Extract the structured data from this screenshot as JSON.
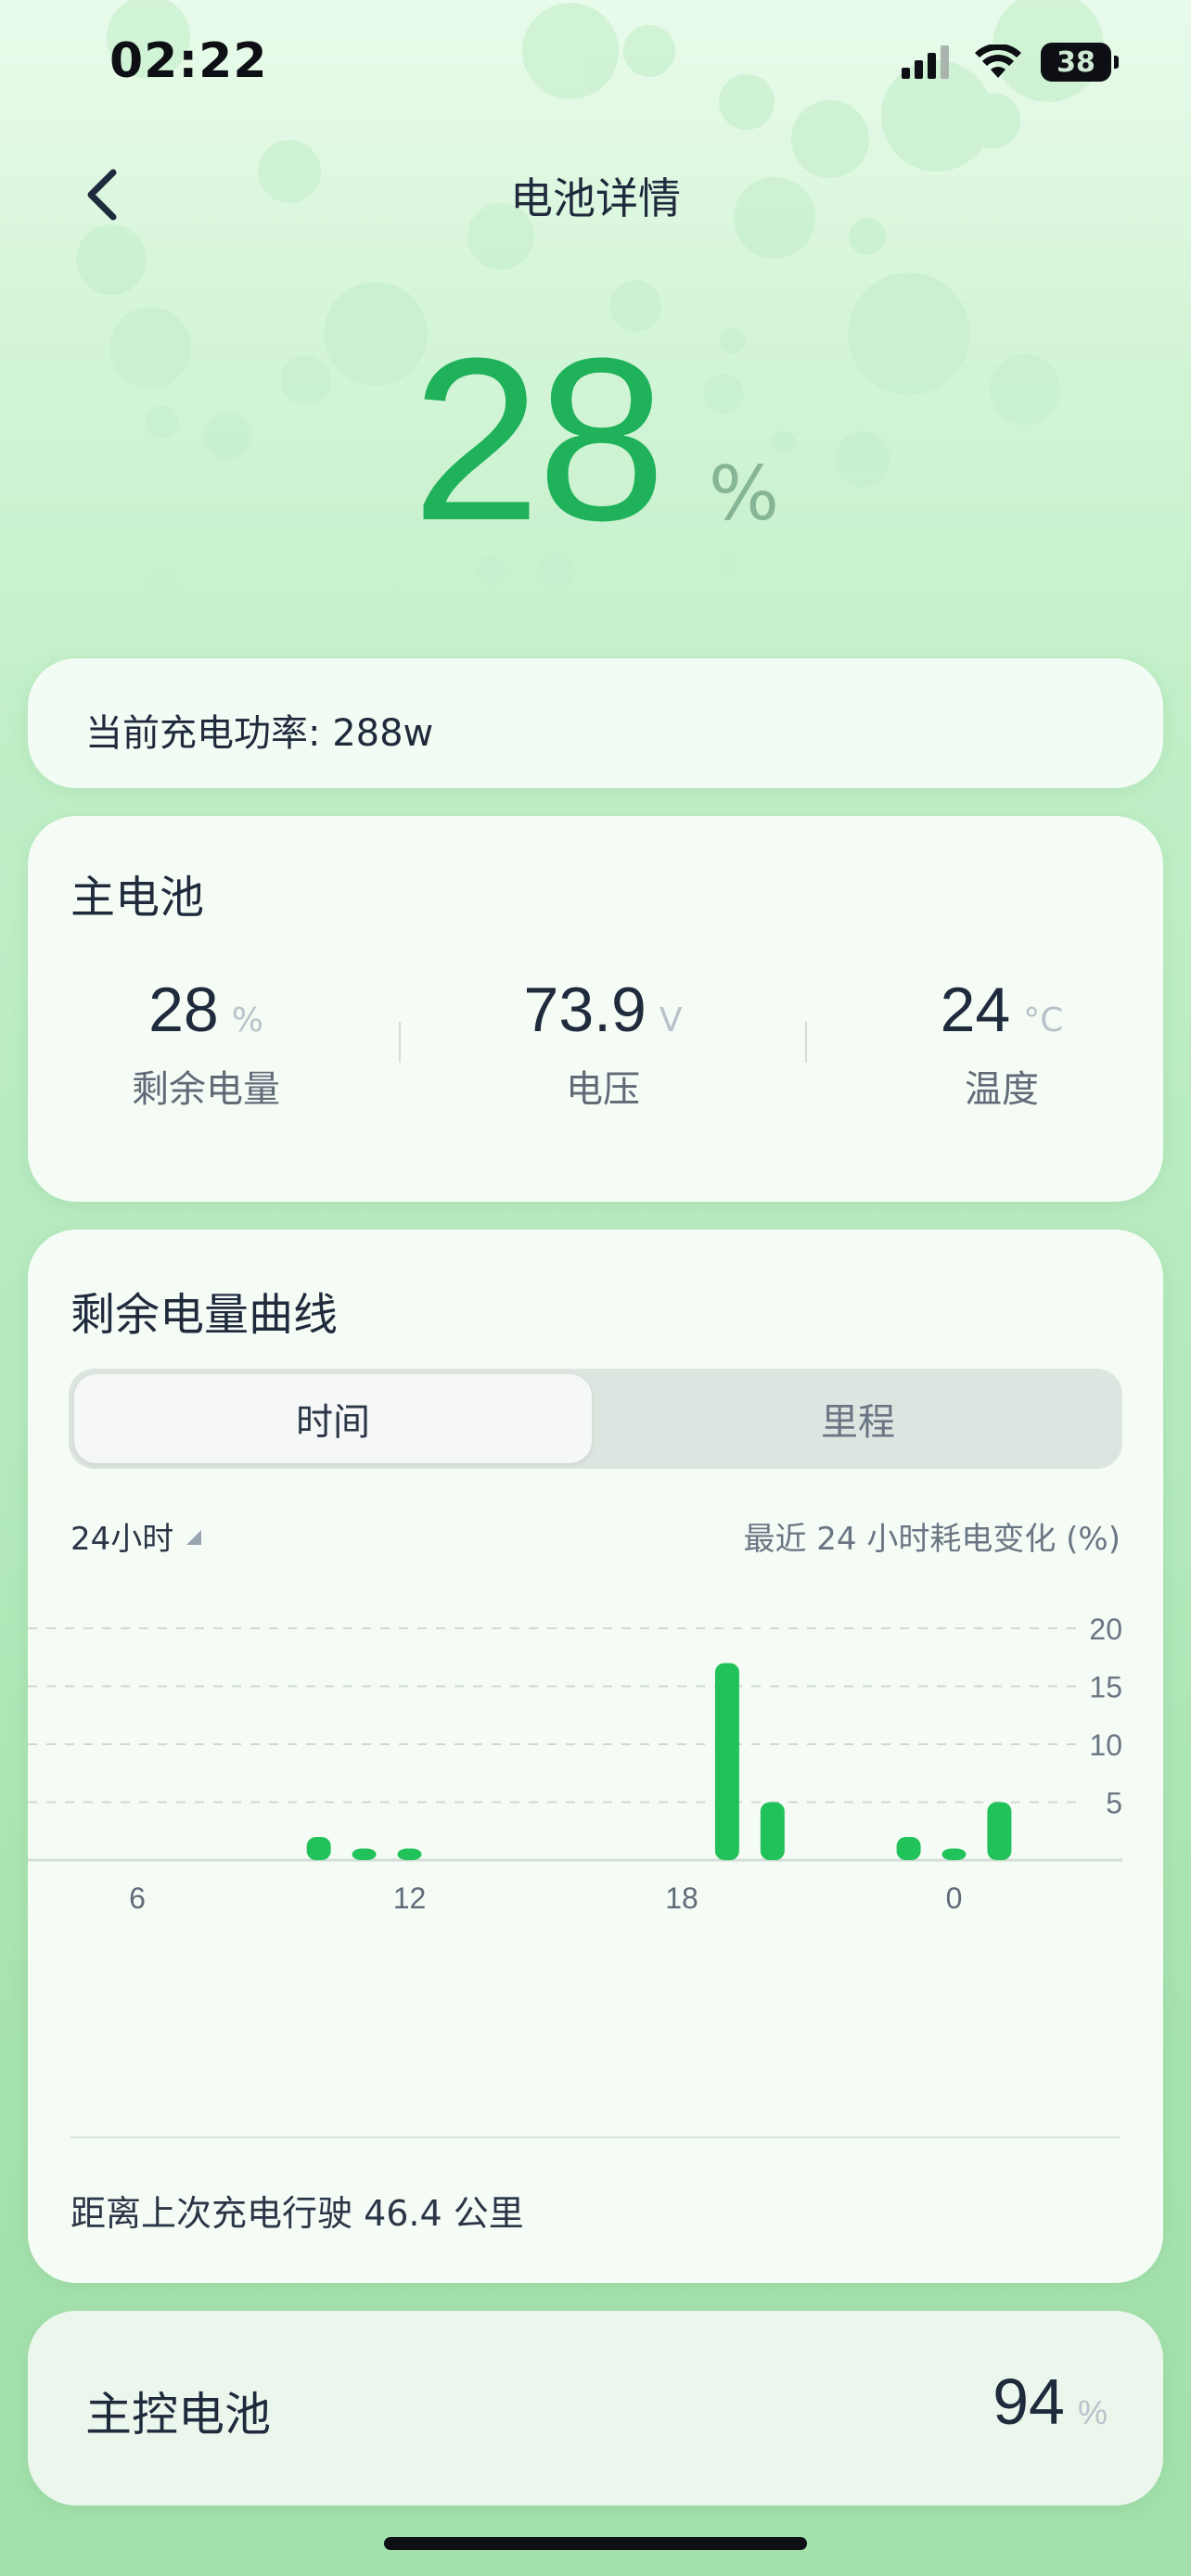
{
  "status_bar": {
    "time": "02:22",
    "battery": "38"
  },
  "nav": {
    "title": "电池详情"
  },
  "hero": {
    "value": "28",
    "unit": "%"
  },
  "charging": {
    "label": "当前充电功率: 288w"
  },
  "main_battery": {
    "title": "主电池",
    "stats": [
      {
        "value": "28",
        "unit": "%",
        "label": "剩余电量"
      },
      {
        "value": "73.9",
        "unit": "V",
        "label": "电压"
      },
      {
        "value": "24",
        "unit": "°C",
        "label": "温度"
      }
    ]
  },
  "curve": {
    "title": "剩余电量曲线",
    "tabs": [
      {
        "label": "时间"
      },
      {
        "label": "里程"
      }
    ],
    "range": "24小时",
    "caption": "最近 24 小时耗电变化 (%)",
    "distance_text": "距离上次充电行驶 46.4 公里"
  },
  "chart_data": {
    "type": "bar",
    "x": [
      10,
      11,
      12,
      19,
      20,
      23,
      0,
      1
    ],
    "values": [
      2,
      1,
      1,
      17,
      5,
      2,
      1,
      5
    ],
    "x_tick_labels": [
      "6",
      "12",
      "18",
      "0"
    ],
    "y_tick_labels": [
      "5",
      "10",
      "15",
      "20"
    ],
    "ylim": [
      0,
      20
    ],
    "grid": true,
    "color": "#22c25a"
  },
  "controller_battery": {
    "title": "主控电池",
    "value": "94",
    "unit": "%"
  },
  "colors": {
    "accent": "#1fb25b",
    "bar": "#22c25a"
  }
}
